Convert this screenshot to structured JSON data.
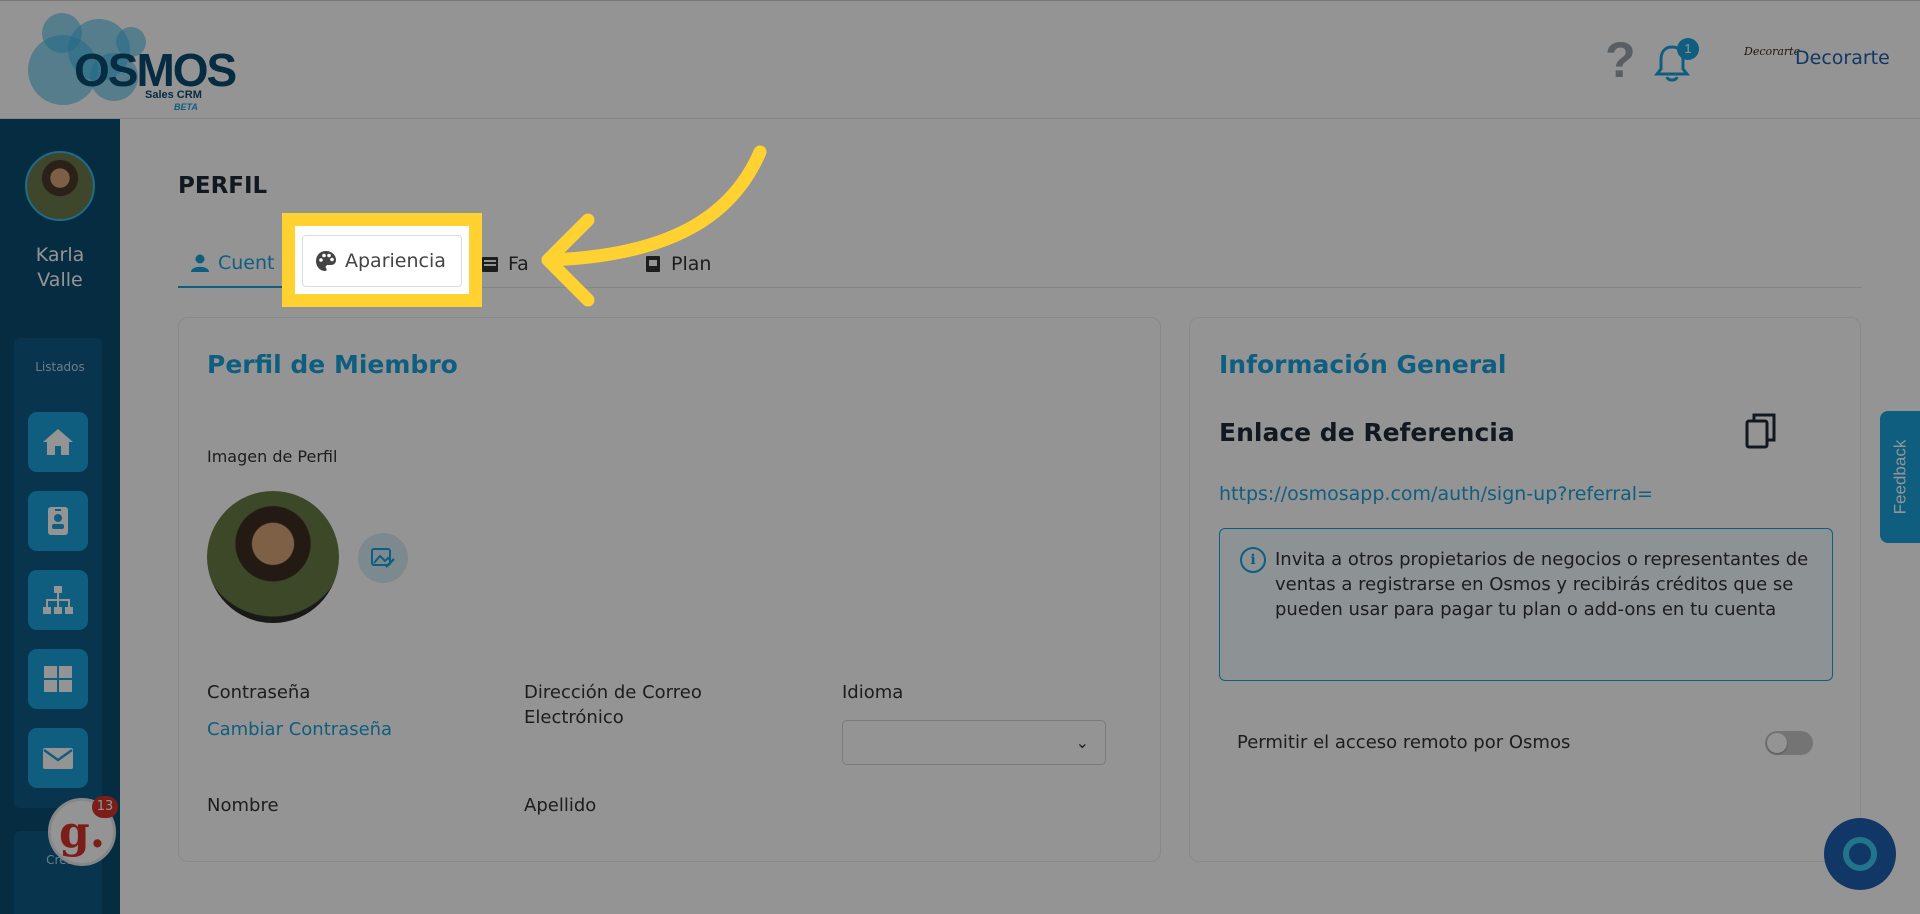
{
  "header": {
    "logo_text": "OSMOS",
    "logo_sub": "Sales CRM",
    "logo_beta": "BETA",
    "help_icon": "question-icon",
    "notifications_count": "1",
    "brand_logo_text": "Decorarte",
    "brand_name": "Decorarte"
  },
  "sidebar": {
    "user_first": "Karla",
    "user_last": "Valle",
    "section_label": "Listados",
    "section_label_2": "Crea",
    "items": [
      {
        "icon": "home-icon"
      },
      {
        "icon": "contact-card-icon"
      },
      {
        "icon": "org-chart-icon"
      },
      {
        "icon": "grid-icon"
      },
      {
        "icon": "mail-icon"
      }
    ],
    "g_badge_letter": "g.",
    "g_badge_count": "13"
  },
  "page": {
    "title": "PERFIL",
    "tabs": [
      {
        "label": "Cuenta",
        "icon": "user-icon",
        "visible_text": "Cuent"
      },
      {
        "label": "Apariencia",
        "icon": "palette-icon"
      },
      {
        "label": "Facturación",
        "icon": "billing-icon",
        "visible_text": "Fa"
      },
      {
        "label": "Plan",
        "icon": "plan-icon"
      }
    ],
    "active_tab": "Cuenta"
  },
  "member_card": {
    "title": "Perfil de Miembro",
    "image_label": "Imagen de Perfil",
    "password_label": "Contraseña",
    "change_password_link": "Cambiar Contraseña",
    "email_label": "Dirección de Correo Electrónico",
    "language_label": "Idioma",
    "language_value": "",
    "first_name_label": "Nombre",
    "last_name_label": "Apellido"
  },
  "general_card": {
    "title": "Información General",
    "ref_title": "Enlace de Referencia",
    "ref_link": "https://osmosapp.com/auth/sign-up?referral=",
    "info_text": "Invita a otros propietarios de negocios o representantes de ventas a registrarse en Osmos y recibirás créditos que se pueden usar para pagar tu plan o add-ons en tu cuenta",
    "remote_access_label": "Permitir el acceso remoto por Osmos",
    "remote_access_enabled": false
  },
  "feedback_label": "Feedback",
  "colors": {
    "primary": "#1aa3db",
    "sidebar": "#0b4c73",
    "highlight": "#ffd232"
  }
}
